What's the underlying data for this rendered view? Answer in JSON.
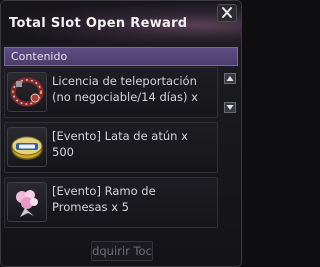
{
  "window": {
    "title": "Total Slot Open Reward",
    "close_icon": "close-icon"
  },
  "section": {
    "label": "Contenido"
  },
  "items": [
    {
      "icon": "teleport-necklace-icon",
      "text": "Licencia de teleportación\n(no negociable/14 días) x"
    },
    {
      "icon": "tuna-can-icon",
      "text": "[Evento] Lata de atún x\n500"
    },
    {
      "icon": "flower-bouquet-icon",
      "text": "[Evento] Ramo de\nPromesas x 5"
    }
  ],
  "scrollbar": {
    "up_icon": "arrow-up-icon",
    "down_icon": "arrow-down-icon"
  },
  "footer": {
    "button_label": "dquirir Toc"
  },
  "colors": {
    "section_header": "#5f4f86",
    "text": "#d4d4dc",
    "title": "#f2f2f2"
  }
}
